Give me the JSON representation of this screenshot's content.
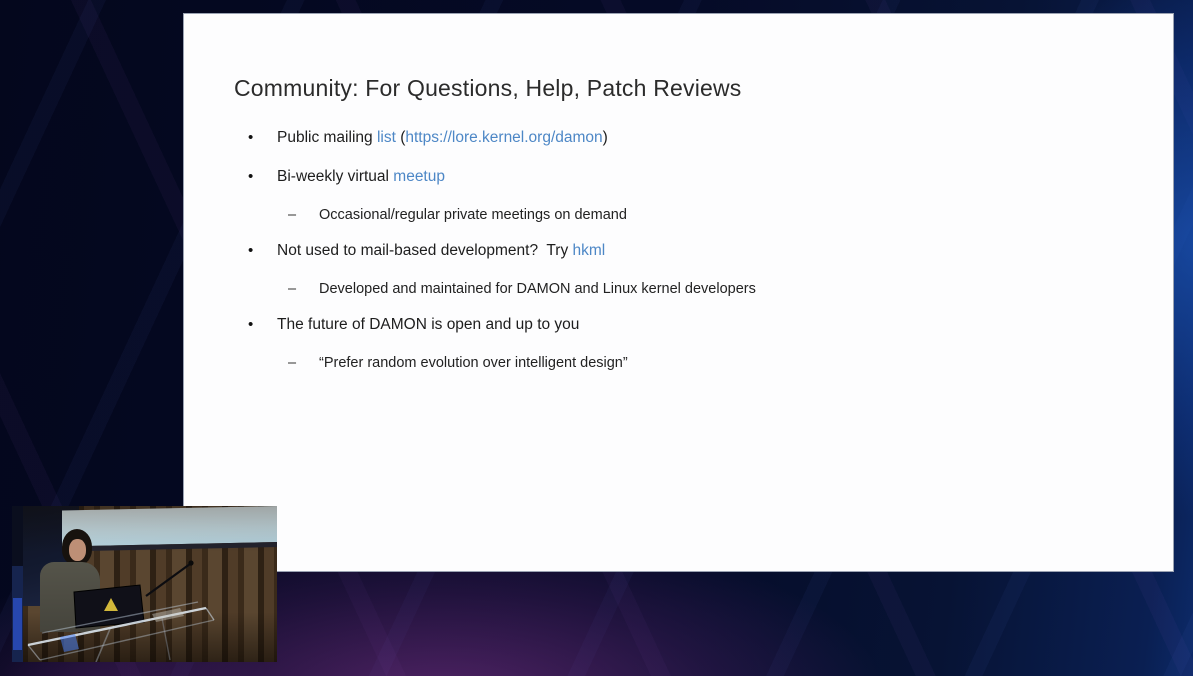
{
  "slide": {
    "title": "Community: For Questions, Help, Patch Reviews",
    "bullet_glyph": "•",
    "sub_bullet_glyph": "–",
    "bullets": [
      {
        "level": 1,
        "segments": [
          {
            "style": "plain",
            "text": "Public mailing "
          },
          {
            "style": "link",
            "text": "list"
          },
          {
            "style": "plain",
            "text": " ("
          },
          {
            "style": "link",
            "text": "https://lore.kernel.org/damon"
          },
          {
            "style": "plain",
            "text": ")"
          }
        ]
      },
      {
        "level": 1,
        "segments": [
          {
            "style": "plain",
            "text": "Bi-weekly virtual "
          },
          {
            "style": "link",
            "text": "meetup"
          }
        ]
      },
      {
        "level": 2,
        "segments": [
          {
            "style": "plain",
            "text": "Occasional/regular private meetings on demand"
          }
        ]
      },
      {
        "level": 1,
        "segments": [
          {
            "style": "plain",
            "text": "Not used to mail-based development?  Try "
          },
          {
            "style": "link",
            "text": "hkml"
          }
        ]
      },
      {
        "level": 2,
        "segments": [
          {
            "style": "plain",
            "text": "Developed and maintained for DAMON and Linux kernel developers"
          }
        ]
      },
      {
        "level": 1,
        "segments": [
          {
            "style": "plain",
            "text": "The future of DAMON is open and up to you"
          }
        ]
      },
      {
        "level": 2,
        "segments": [
          {
            "style": "plain",
            "text": "“Prefer random evolution over intelligent design”"
          }
        ]
      }
    ]
  },
  "colors": {
    "link_blue": "#4d87c6",
    "slide_text": "#1d1d1d",
    "slide_background": "#fdfdfe",
    "stage_navy": "#050a26",
    "right_glow_blue": "#1e5fcd",
    "bottom_glow_purple": "#9e3ea8"
  }
}
